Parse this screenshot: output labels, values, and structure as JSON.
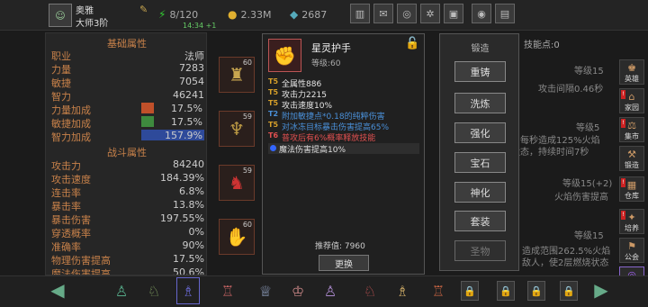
{
  "player": {
    "name": "奥雅",
    "rank": "大师3阶",
    "stamina": "8/120",
    "gold": "2.33M",
    "diamond": "2687",
    "time": "14:34 +1"
  },
  "left_panel": {
    "basic_title": "基础属性",
    "basic": [
      {
        "k": "职业",
        "v": "法师"
      },
      {
        "k": "力量",
        "v": "7283"
      },
      {
        "k": "敏捷",
        "v": "7054"
      },
      {
        "k": "智力",
        "v": "46241"
      }
    ],
    "bonus": [
      {
        "k": "力量加成",
        "v": "17.5%",
        "pct": 17.5,
        "color": "#c0502a"
      },
      {
        "k": "敏捷加成",
        "v": "17.5%",
        "pct": 17.5,
        "color": "#3e8a3e"
      },
      {
        "k": "智力加成",
        "v": "157.9%",
        "pct": 100,
        "color": "#2e4a9a"
      }
    ],
    "combat_title": "战斗属性",
    "combat": [
      {
        "k": "攻击力",
        "v": "84240"
      },
      {
        "k": "攻击速度",
        "v": "184.39%"
      },
      {
        "k": "连击率",
        "v": "6.8%"
      },
      {
        "k": "暴击率",
        "v": "13.8%"
      },
      {
        "k": "暴击伤害",
        "v": "197.55%"
      },
      {
        "k": "穿透概率",
        "v": "0%"
      },
      {
        "k": "准确率",
        "v": "90%"
      },
      {
        "k": "物理伤害提高",
        "v": "17.5%"
      },
      {
        "k": "魔法伤害提高",
        "v": "50.6%"
      }
    ]
  },
  "slots": [
    {
      "num": "60"
    },
    {
      "num": "59"
    },
    {
      "num": "59"
    },
    {
      "num": "60"
    }
  ],
  "bg_right": {
    "skill_pts": "技能点:0",
    "lv1": "等级15",
    "t1": "攻击间隔0.46秒",
    "lv2": "等级5",
    "t2": "，每秒造成125%火焰",
    "t3": "状态，持续时间7秒",
    "lv3": "等级15(+2)",
    "t4": "火焰伤害提高",
    "lv4": "等级15",
    "t5": "造成范围262.5%火焰",
    "t6": "敌人，使2层燃烧状态"
  },
  "tooltip": {
    "name": "星灵护手",
    "level": "等级:60",
    "affixes": [
      {
        "tier": "T5",
        "text": "全属性886",
        "tc": "#d7a02a",
        "c": "#e6e6e6"
      },
      {
        "tier": "T5",
        "text": "攻击力2215",
        "tc": "#d7a02a",
        "c": "#e6e6e6"
      },
      {
        "tier": "T5",
        "text": "攻击速度10%",
        "tc": "#d7a02a",
        "c": "#e6e6e6"
      },
      {
        "tier": "T2",
        "text": "附加敏捷点*0.18的纯粹伤害",
        "tc": "#4a90d9",
        "c": "#4a90d9"
      },
      {
        "tier": "T5",
        "text": "对冰冻目标暴击伤害提高65%",
        "tc": "#d7a02a",
        "c": "#4a90d9"
      },
      {
        "tier": "T6",
        "text": "普攻后有6%概率释放技能",
        "tc": "#e05050",
        "c": "#e05050"
      }
    ],
    "magic": "魔法伤害提高10%",
    "recommend": "推荐值: 7960",
    "replace": "更换"
  },
  "forge": {
    "title": "锻造",
    "buttons": [
      "重铸",
      "洗炼",
      "强化",
      "宝石",
      "神化",
      "套装",
      "圣物"
    ]
  },
  "sidebar": [
    "英雄",
    "家园",
    "集市",
    "锻造",
    "仓库",
    "培养",
    "公会",
    "战斗"
  ]
}
